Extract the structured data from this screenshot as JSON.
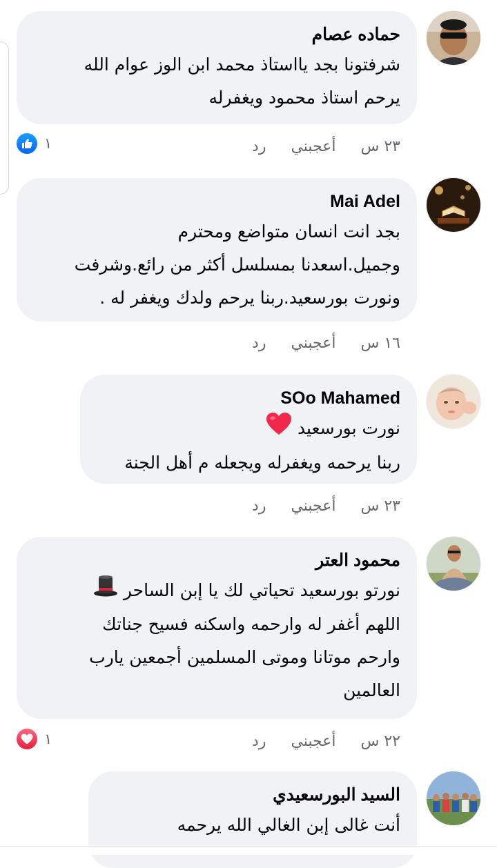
{
  "comments": [
    {
      "author": "حماده عصام",
      "lines": [
        "شرفتونا بجد يااستاذ محمد ابن الوز عوام الله",
        "يرحم استاذ محمود ويغفرله"
      ],
      "time": "٢٣ س",
      "like_label": "أعجبني",
      "reply_label": "رد",
      "reaction": {
        "type": "like-icon",
        "count": "١"
      }
    },
    {
      "author": "Mai Adel",
      "lines": [
        "بجد انت انسان متواضع ومحترم",
        "وجميل.اسعدنا بمسلسل أكثر من رائع.وشرفت",
        "ونورت بورسعيد.ربنا يرحم ولدك ويغفر له ."
      ],
      "time": "١٦ س",
      "like_label": "أعجبني",
      "reply_label": "رد"
    },
    {
      "author": "SOo Mahamed",
      "lines": [
        "نورت بورسعيد",
        "ربنا يرحمه ويغفرله ويجعله م أهل الجنة"
      ],
      "emoji": "red-heart-emoji",
      "time": "٢٣ س",
      "like_label": "أعجبني",
      "reply_label": "رد"
    },
    {
      "author": "محمود العتر",
      "lines": [
        "نورتو بورسعيد تحياتي لك يا إبن الساحر",
        "اللهم أغفر له وارحمه واسكنه فسيح جناتك",
        "وارحم موتانا وموتى المسلمين أجمعين يارب",
        "العالمين"
      ],
      "emoji": "top-hat-emoji",
      "time": "٢٢ س",
      "like_label": "أعجبني",
      "reply_label": "رد",
      "reaction": {
        "type": "love-icon",
        "count": "١"
      }
    },
    {
      "author": "السيد البورسعيدي",
      "lines": [
        "أنت غالى إبن الغالي الله يرحمه"
      ]
    }
  ],
  "colors": {
    "bubble": "#f0f2f5",
    "secondary_text": "#65676b",
    "like_blue": "#0866ff",
    "love_red": "#f02849"
  }
}
